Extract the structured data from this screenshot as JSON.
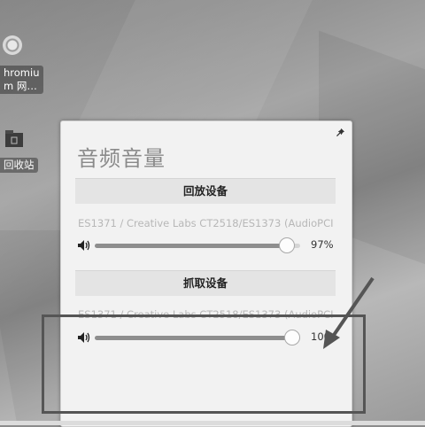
{
  "desktop": {
    "icons": [
      {
        "name": "chromium",
        "label": "hromiu\nm 网…"
      },
      {
        "name": "trash",
        "label": "回收站"
      }
    ]
  },
  "volume_panel": {
    "title": "音频音量",
    "playback": {
      "header": "回放设备",
      "device": "ES1371 / Creative Labs CT2518/ES1373 (AudioPCI 6…",
      "volume_percent": 97,
      "volume_label": "97%"
    },
    "capture": {
      "header": "抓取设备",
      "device": "ES1371 / Creative Labs CT2518/ES1373 (AudioPCI 6…",
      "volume_percent": 100,
      "volume_label": "100"
    }
  },
  "colors": {
    "panel_bg": "#f2f2f2",
    "annotation": "#555555"
  }
}
